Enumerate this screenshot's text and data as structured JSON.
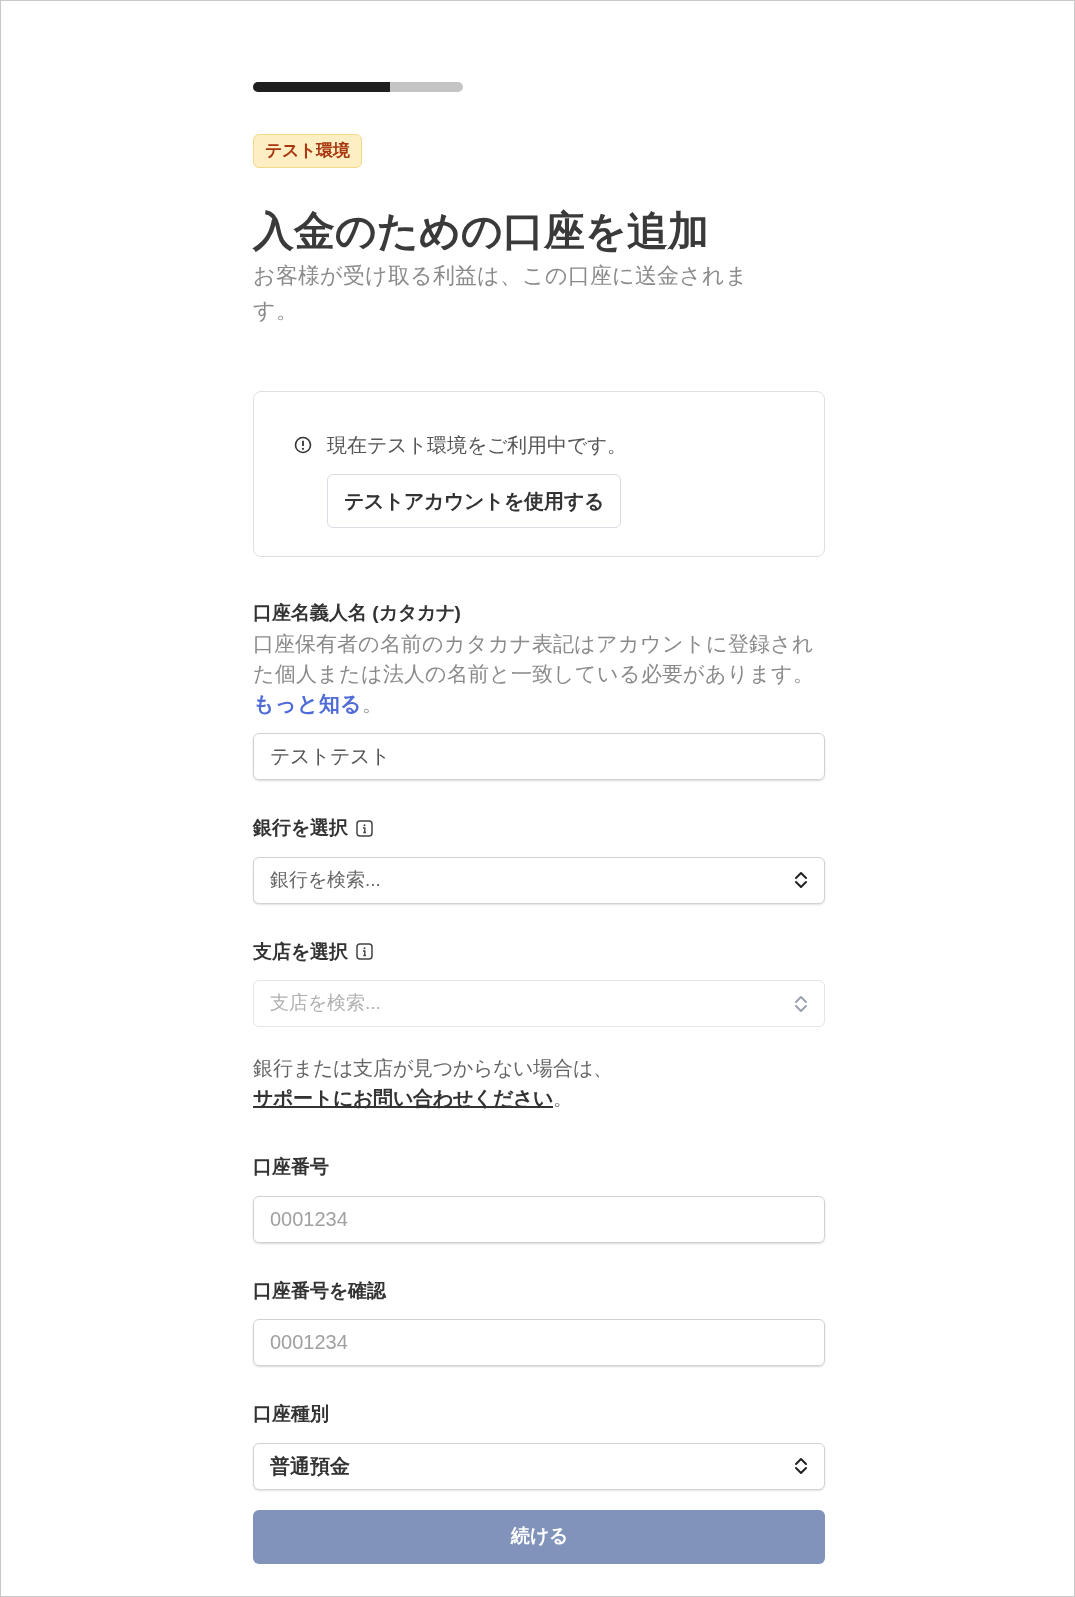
{
  "progress": {
    "level": 0.65
  },
  "badge": "テスト環境",
  "title": "入金のための口座を追加",
  "subtitle": "お客様が受け取る利益は、この口座に送金されます。",
  "notice": {
    "message": "現在テスト環境をご利用中です。",
    "button": "テストアカウントを使用する"
  },
  "fields": [
    {
      "kind": "text",
      "label": "口座名義人名 (カタカナ)",
      "description": "口座保有者の名前のカタカナ表記はアカウントに登録された個人または法人の名前と一致している必要があります。",
      "link": "もっと知る",
      "description_end": "。",
      "value": "テストテスト"
    },
    {
      "kind": "select",
      "label": "銀行を選択",
      "info": true,
      "placeholder": "銀行を検索...",
      "disabled": false
    },
    {
      "kind": "select",
      "label": "支店を選択",
      "info": true,
      "placeholder": "支店を検索...",
      "disabled": true
    },
    {
      "kind": "note",
      "text": "銀行または支店が見つからない場合は、",
      "link": "サポートにお問い合わせください",
      "end": "。"
    },
    {
      "kind": "text",
      "label": "口座番号",
      "placeholder": "0001234"
    },
    {
      "kind": "text",
      "label": "口座番号を確認",
      "placeholder": "0001234"
    },
    {
      "kind": "select",
      "label": "口座種別",
      "value": "普通預金",
      "disabled": false
    }
  ],
  "submit": {
    "label": "続ける",
    "disabled": true
  }
}
